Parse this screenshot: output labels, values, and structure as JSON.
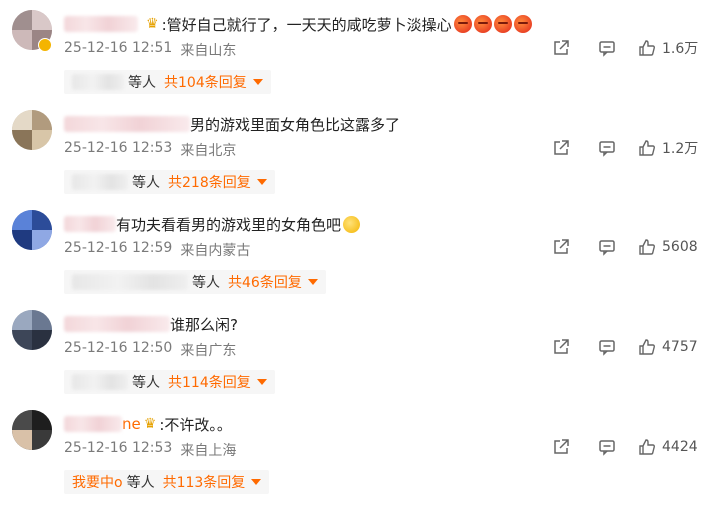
{
  "comments": [
    {
      "text": ":管好自己就行了，一天天的咸吃萝卜淡操心",
      "date": "25-12-16 12:51",
      "location": "来自山东",
      "likes": "1.6万",
      "reply_names": "等人",
      "reply_count": "共104条回复",
      "emoji_count": 4,
      "avatar_color": "#b9a4a4"
    },
    {
      "text": "男的游戏里面女角色比这露多了",
      "date": "25-12-16 12:53",
      "location": "来自北京",
      "likes": "1.2万",
      "reply_names": "等人",
      "reply_count": "共218条回复",
      "avatar_color": "#c8b79e"
    },
    {
      "text": "有功夫看看男的游戏里的女角色吧",
      "date": "25-12-16 12:59",
      "location": "来自内蒙古",
      "likes": "5608",
      "reply_names": "等人",
      "reply_count": "共46条回复",
      "avatar_color": "#3b5fb5"
    },
    {
      "text": "谁那么闲?",
      "date": "25-12-16 12:50",
      "location": "来自广东",
      "likes": "4757",
      "reply_names": "等人",
      "reply_count": "共114条回复",
      "avatar_color": "#7d8aa0"
    },
    {
      "name_suffix": "ne",
      "text": ":不许改。。",
      "date": "25-12-16 12:53",
      "location": "来自上海",
      "likes": "4424",
      "reply_user": "我要中o",
      "reply_names": "等人",
      "reply_count": "共113条回复",
      "avatar_color": "#2e2e2e"
    }
  ],
  "colors": {
    "accent": "#ff6a00",
    "meta": "#7a7a7a",
    "reply_bg": "#f6f6f6"
  },
  "icons": [
    "share-icon",
    "comment-icon",
    "like-icon",
    "crown-icon",
    "chevron-down-icon"
  ]
}
